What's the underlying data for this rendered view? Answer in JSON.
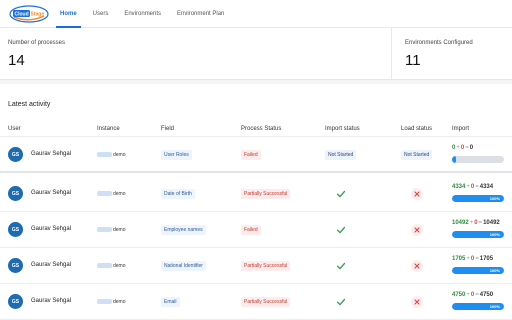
{
  "brand": {
    "logo_text": "CloudStage",
    "color": "#1b6fd8"
  },
  "nav": [
    {
      "label": "Home",
      "active": true
    },
    {
      "label": "Users",
      "active": false
    },
    {
      "label": "Environments",
      "active": false
    },
    {
      "label": "Environment Plan",
      "active": false
    }
  ],
  "stats": {
    "processes": {
      "label": "Number of processes",
      "value": "14"
    },
    "environments": {
      "label": "Environments Configured",
      "value": "11"
    }
  },
  "activity": {
    "title": "Latest activity",
    "columns": {
      "user": "User",
      "instance": "Instance",
      "field": "Field",
      "process_status": "Process Status",
      "import_status": "Import status",
      "load_status": "Load status",
      "import": "Import"
    },
    "rows": [
      {
        "initials": "GS",
        "user": "Gaurav Sehgal",
        "instance": "demo",
        "field": "User Roles",
        "process_status": "Failed",
        "import_status": "Not Started",
        "load_status": "Not Started",
        "success": "0",
        "failed": "0",
        "total": "0",
        "progress_label": "",
        "progress": 0
      },
      {
        "initials": "GS",
        "user": "Gaurav Sehgal",
        "instance": "demo",
        "field": "Date of Birth",
        "process_status": "Partially Successful",
        "import_status": "success",
        "load_status": "failed",
        "success": "4334",
        "failed": "0",
        "total": "4334",
        "progress_label": "100%",
        "progress": 1.0
      },
      {
        "initials": "GS",
        "user": "Gaurav Sehgal",
        "instance": "demo",
        "field": "Employee names",
        "process_status": "Failed",
        "import_status": "success",
        "load_status": "failed",
        "success": "10492",
        "failed": "0",
        "total": "10492",
        "progress_label": "100%",
        "progress": 1.0
      },
      {
        "initials": "GS",
        "user": "Gaurav Sehgal",
        "instance": "demo",
        "field": "National Identifier",
        "process_status": "Partially Successful",
        "import_status": "success",
        "load_status": "failed",
        "success": "1705",
        "failed": "0",
        "total": "1705",
        "progress_label": "100%",
        "progress": 1.0
      },
      {
        "initials": "GS",
        "user": "Gaurav Sehgal",
        "instance": "demo",
        "field": "Email",
        "process_status": "Partially Successful",
        "import_status": "success",
        "load_status": "failed",
        "success": "4750",
        "failed": "0",
        "total": "4750",
        "progress_label": "100%",
        "progress": 1.0
      }
    ]
  },
  "icons": {
    "import_success": "check-icon",
    "load_failed": "cross-icon"
  },
  "colors": {
    "success": "#2e8b3e",
    "failed": "#d64545",
    "progress": "#1f8ef1",
    "avatar": "#1e6bb0"
  }
}
